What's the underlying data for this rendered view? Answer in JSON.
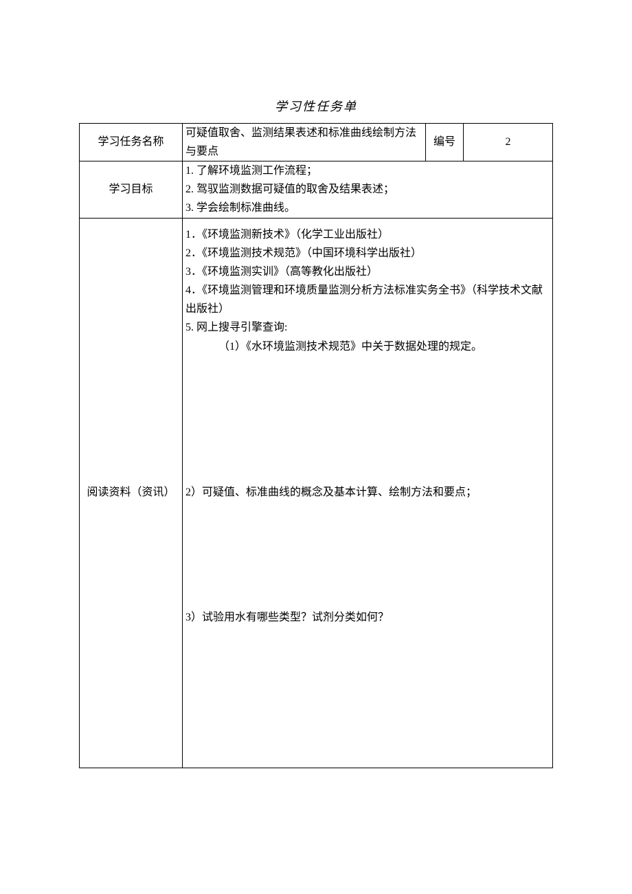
{
  "title": "学习性任务单",
  "row1": {
    "task_name_label": "学习任务名称",
    "task_name_value": "可疑值取舍、监测结果表述和标准曲线绘制方法与要点",
    "number_label": "编号",
    "number_value": "2"
  },
  "row2": {
    "goals_label": "学习目标",
    "goals": [
      "1. 了解环境监测工作流程；",
      "2. 驾驭监测数据可疑值的取舍及结果表述；",
      "3. 学会绘制标准曲线。"
    ]
  },
  "row3": {
    "reading_label": "阅读资料（资讯）",
    "refs": [
      "1．《环境监测新技术》（化学工业出版社）",
      "2．《环境监测技术规范》（中国环境科学出版社）",
      "3．《环境监测实训》（高等教化出版社）",
      "4．《环境监测管理和环境质量监测分析方法标准实务全书》（科学技术文献出版社）",
      "5. 网上搜寻引擎查询:"
    ],
    "sub1": "（1）《水环境监测技术规范》中关于数据处理的规定。",
    "q2": "2）可疑值、标准曲线的概念及基本计算、绘制方法和要点；",
    "q3": "3）试验用水有哪些类型？试剂分类如何？"
  }
}
